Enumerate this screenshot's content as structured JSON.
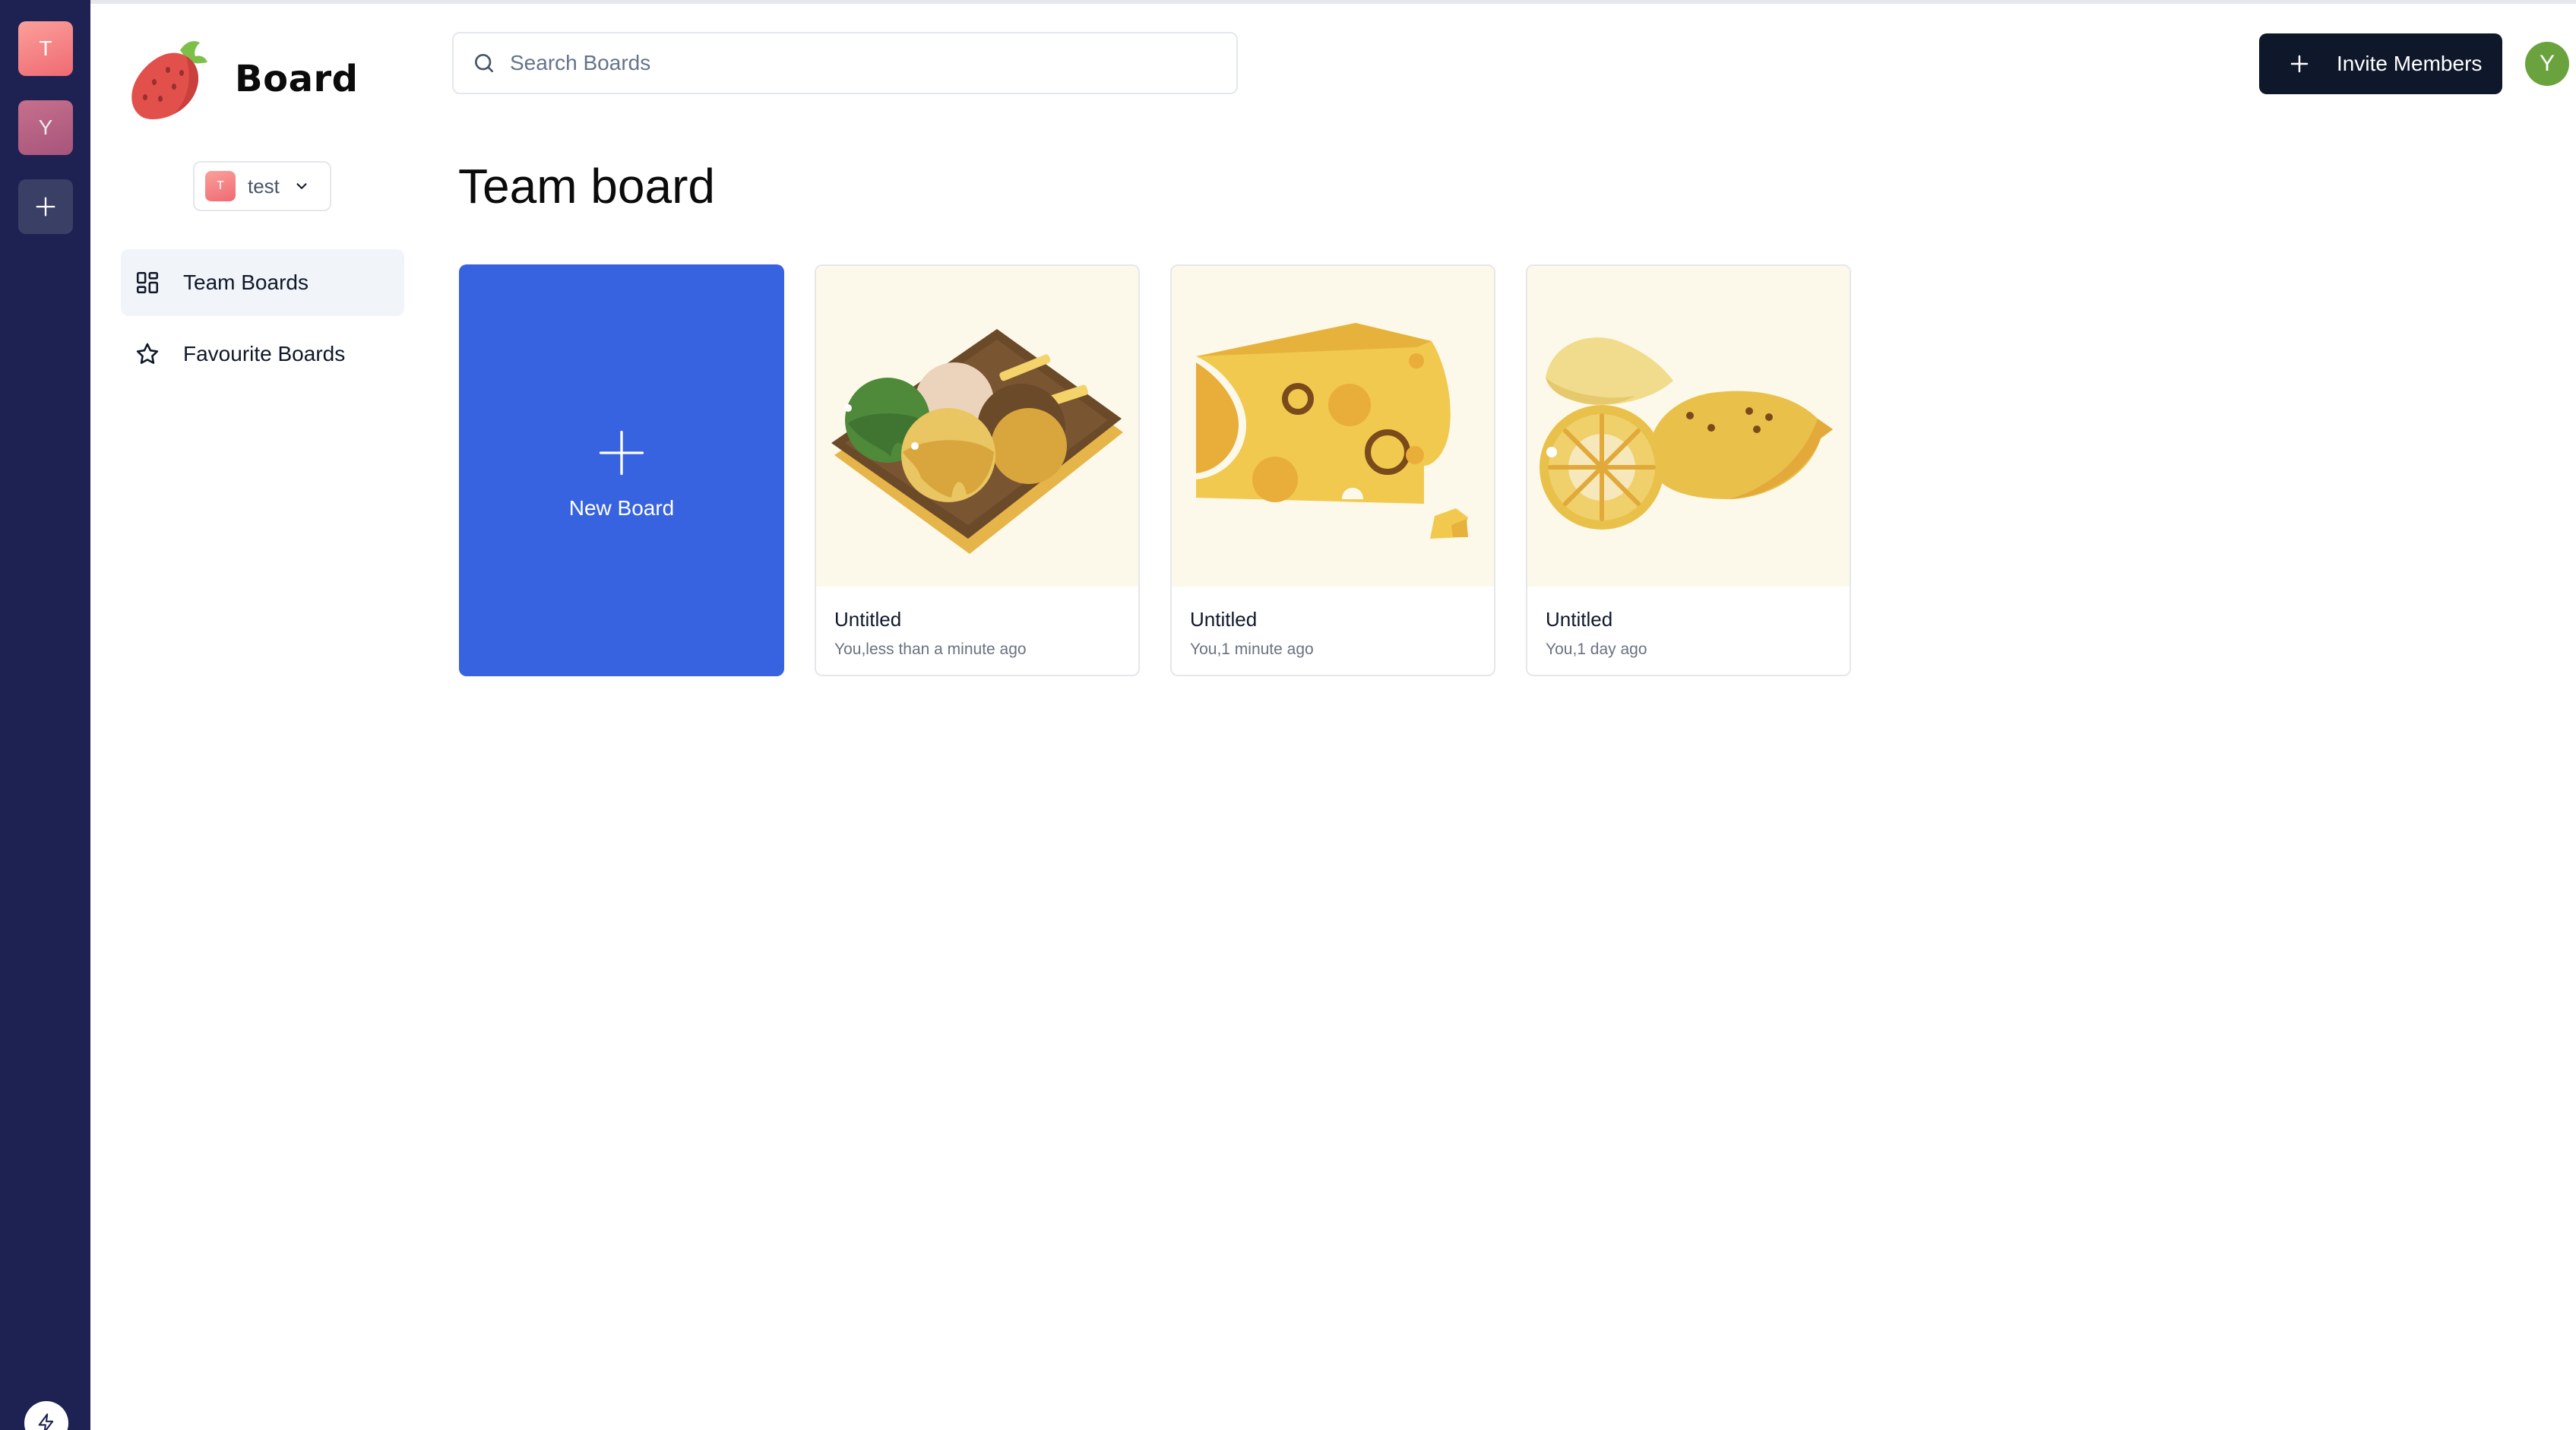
{
  "app": {
    "name": "Board"
  },
  "orgs": [
    {
      "initial": "T",
      "name": "test"
    },
    {
      "initial": "Y"
    }
  ],
  "org_switcher": {
    "initial": "T",
    "name": "test"
  },
  "sidebar": {
    "items": [
      {
        "label": "Team Boards",
        "icon": "dashboard-icon",
        "active": true
      },
      {
        "label": "Favourite Boards",
        "icon": "star-icon",
        "active": false
      }
    ]
  },
  "search": {
    "placeholder": "Search Boards",
    "value": ""
  },
  "header": {
    "invite_label": "Invite Members",
    "user_initial": "Y"
  },
  "main": {
    "title": "Team board",
    "new_board_label": "New Board",
    "boards": [
      {
        "title": "Untitled",
        "subtitle": "You,less than a minute ago",
        "image": "takoyaki-illustration"
      },
      {
        "title": "Untitled",
        "subtitle": "You,1 minute ago",
        "image": "cheese-illustration"
      },
      {
        "title": "Untitled",
        "subtitle": "You,1 day ago",
        "image": "lemon-illustration"
      }
    ]
  },
  "colors": {
    "rail": "#1e2252",
    "accent": "#3762e0",
    "button_dark": "#0f172a",
    "avatar": "#6aa33e"
  }
}
